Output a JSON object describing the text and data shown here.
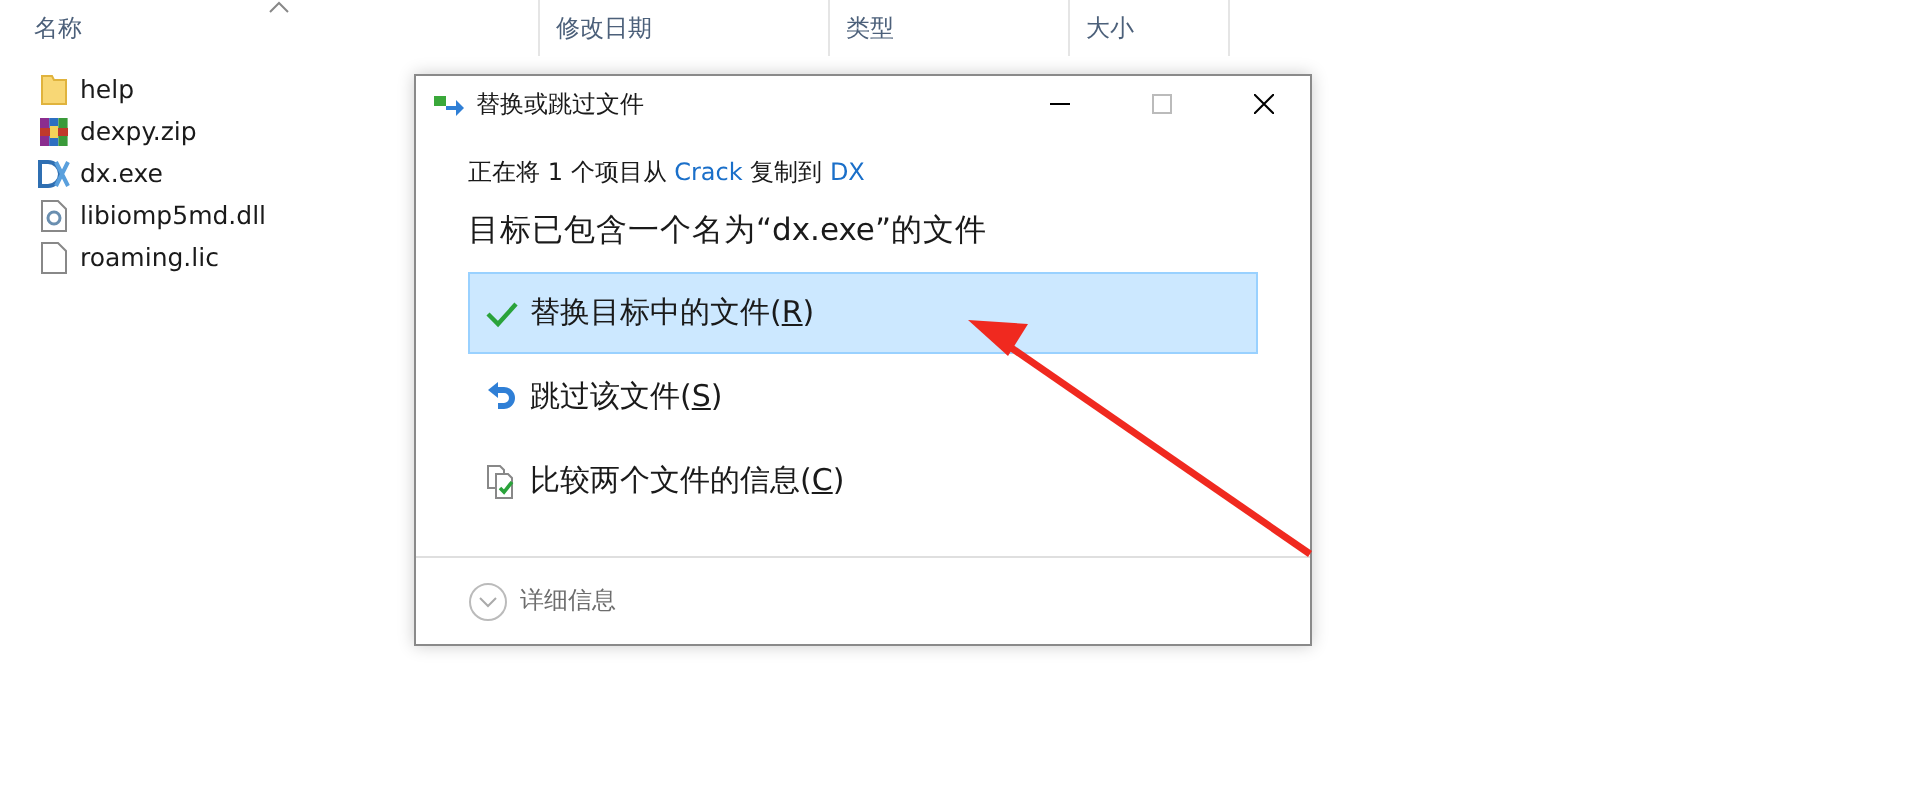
{
  "explorer": {
    "columns": [
      {
        "label": "名称",
        "sorted": true
      },
      {
        "label": "修改日期",
        "sorted": false
      },
      {
        "label": "类型",
        "sorted": false
      },
      {
        "label": "大小",
        "sorted": false
      }
    ],
    "files": [
      {
        "name": "help",
        "kind": "folder"
      },
      {
        "name": "dexpy.zip",
        "kind": "archive"
      },
      {
        "name": "dx.exe",
        "kind": "app"
      },
      {
        "name": "libiomp5md.dll",
        "kind": "dll"
      },
      {
        "name": "roaming.lic",
        "kind": "file"
      }
    ]
  },
  "dialog": {
    "title": "替换或跳过文件",
    "message": [
      {
        "text": "正在将 1 个项目从 ",
        "kind": "text"
      },
      {
        "text": "Crack",
        "kind": "link"
      },
      {
        "text": " 复制到 ",
        "kind": "text"
      },
      {
        "text": "DX",
        "kind": "link"
      }
    ],
    "heading": "目标已包含一个名为“dx.exe”的文件",
    "options": [
      {
        "label": "替换目标中的文件",
        "shortcut": "(R)",
        "kind": "replace",
        "selected": true
      },
      {
        "label": "跳过该文件",
        "shortcut": "(S)",
        "kind": "skip",
        "selected": false
      },
      {
        "label": "比较两个文件的信息",
        "shortcut": "(C)",
        "kind": "compare",
        "selected": false
      }
    ],
    "details": {
      "label": "详细信息",
      "expanded": false
    }
  }
}
